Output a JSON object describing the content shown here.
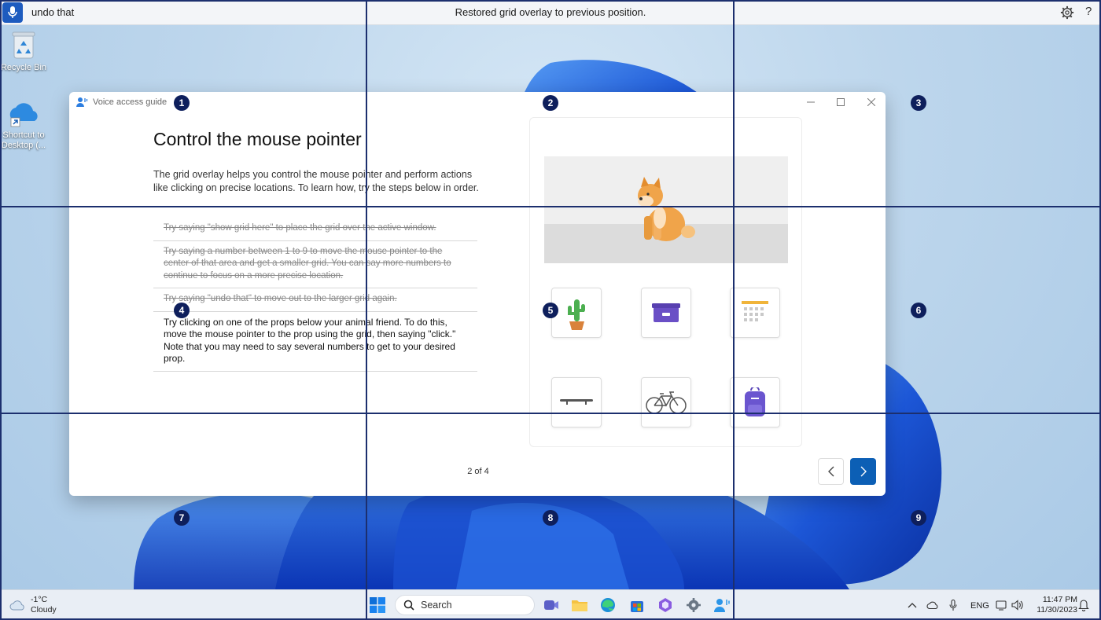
{
  "voice_bar": {
    "command_text": "undo that",
    "status_text": "Restored grid overlay to previous position.",
    "help_label": "?"
  },
  "desktop": {
    "icons": [
      {
        "label": "Recycle Bin",
        "icon": "recycle-bin-icon"
      },
      {
        "label": "Shortcut to Desktop (...",
        "icon": "onedrive-icon"
      }
    ]
  },
  "guide": {
    "window_title": "Voice access guide",
    "heading": "Control the mouse pointer",
    "intro": "The grid overlay helps you control the mouse pointer and perform actions like clicking on precise locations. To learn how, try the steps below in order.",
    "steps": [
      {
        "text": "Try saying \"show grid here\" to place the grid over the active window.",
        "completed": true
      },
      {
        "text": "Try saying a number between 1 to 9 to move the mouse pointer to the center of that area and get a smaller grid. You can say more numbers to continue to focus on a more precise location.",
        "completed": true
      },
      {
        "text": "Try saying \"undo that\" to move out to the larger grid again.",
        "completed": true
      },
      {
        "text": "Try clicking on one of the props below your animal friend. To do this, move the mouse pointer to the prop using the grid, then saying \"click.\" Note that you may need to say several numbers to get to your desired prop.",
        "completed": false
      }
    ],
    "page_indicator": "2 of 4",
    "props": [
      "cactus-icon",
      "storage-box-icon",
      "calendar-icon",
      "skateboard-icon",
      "bicycle-icon",
      "backpack-icon"
    ]
  },
  "grid": {
    "numbers": [
      "1",
      "2",
      "3",
      "4",
      "5",
      "6",
      "7",
      "8",
      "9"
    ]
  },
  "taskbar": {
    "weather_temp": "-1°C",
    "weather_desc": "Cloudy",
    "search_label": "Search",
    "language": "ENG",
    "time": "11:47 PM",
    "date": "11/30/2023"
  },
  "colors": {
    "accent": "#0c5fb5",
    "grid_line": "#1c2f6e",
    "grid_badge": "#0e1f5c",
    "wallpaper_bloom": "#1c56d6"
  }
}
